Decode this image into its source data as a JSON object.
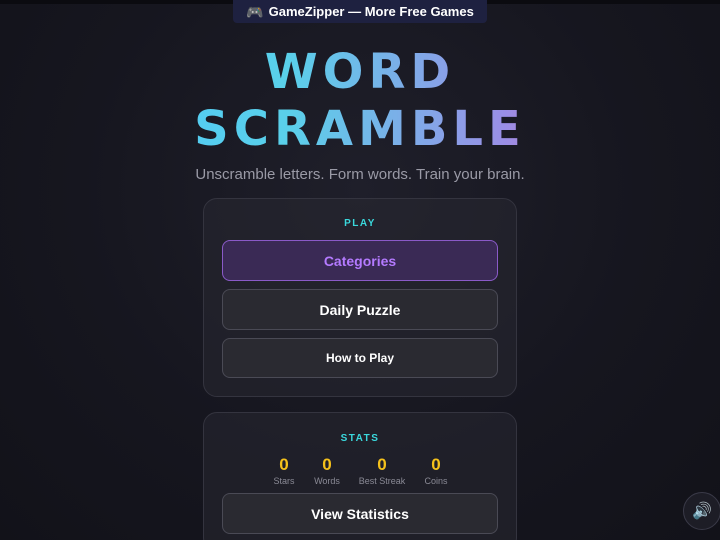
{
  "promo": {
    "icon": "gamepad-icon",
    "glyph": "🎮",
    "label": "GameZipper — More Free Games"
  },
  "title": {
    "line1": "WORD",
    "line2": "SCRAMBLE"
  },
  "tagline": "Unscramble letters. Form words. Train your brain.",
  "play": {
    "heading": "PLAY",
    "buttons": {
      "categories": "Categories",
      "daily": "Daily Puzzle",
      "howto": "How to Play"
    }
  },
  "stats": {
    "heading": "STATS",
    "items": [
      {
        "value": "0",
        "label": "Stars"
      },
      {
        "value": "0",
        "label": "Words"
      },
      {
        "value": "0",
        "label": "Best Streak"
      },
      {
        "value": "0",
        "label": "Coins"
      }
    ],
    "view_button": "View Statistics"
  },
  "sound": {
    "icon": "speaker-icon",
    "glyph": "🔊"
  },
  "colors": {
    "accent_cyan": "#3ad8dc",
    "accent_purple": "#b47aff",
    "stat_gold": "#f5c11b"
  }
}
